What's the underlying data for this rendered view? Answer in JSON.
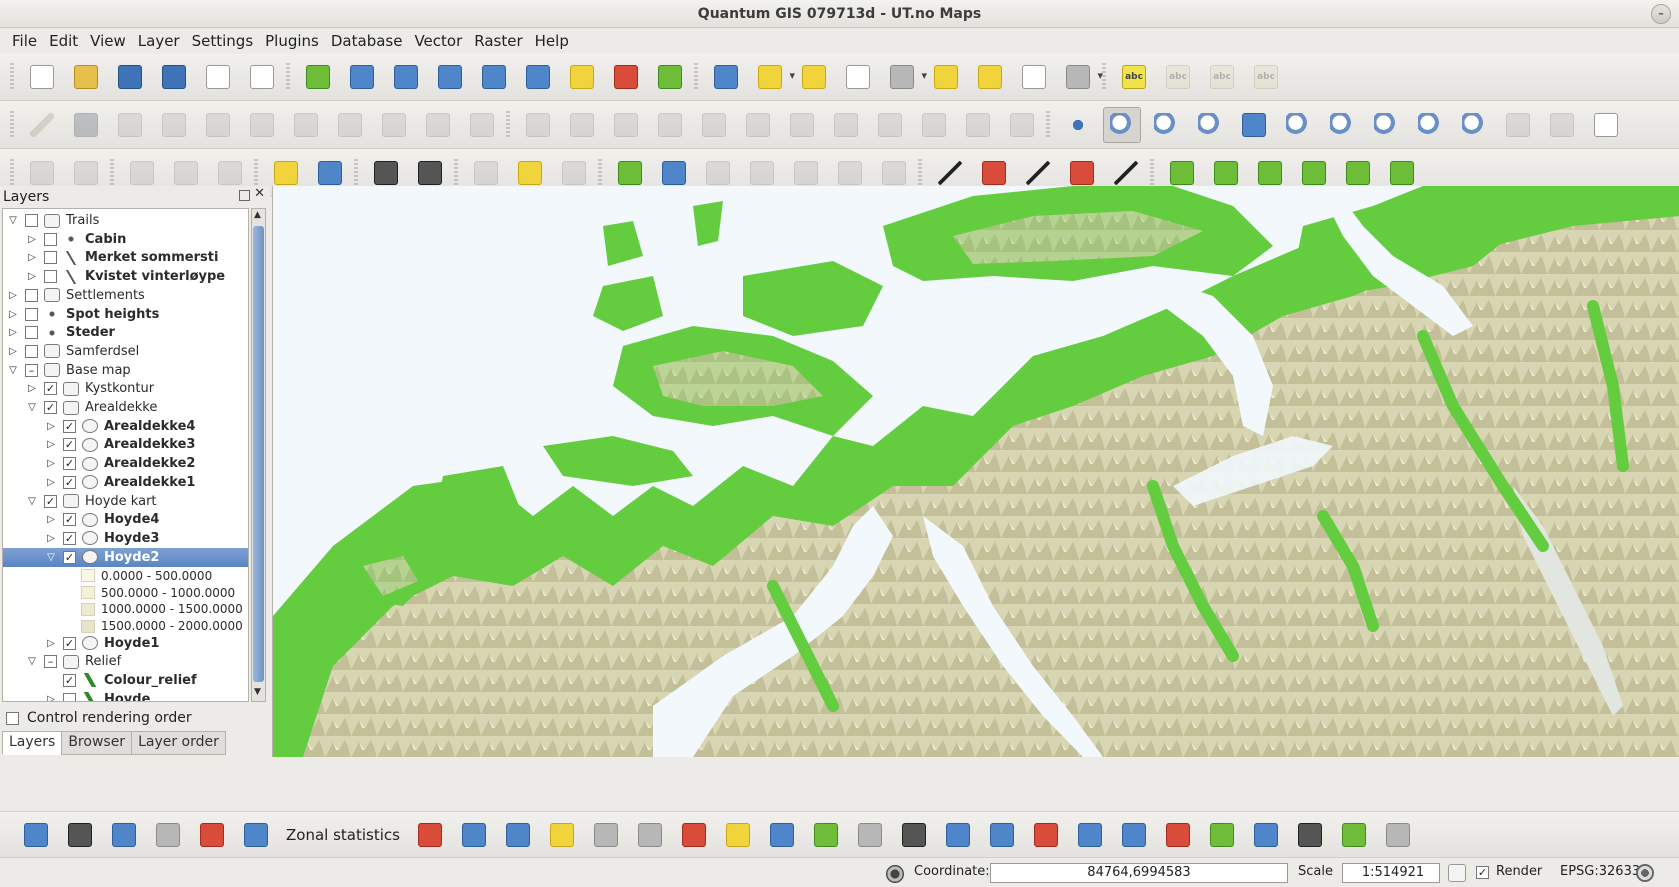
{
  "window": {
    "title": "Quantum GIS 079713d - UT.no Maps"
  },
  "menu": [
    "File",
    "Edit",
    "View",
    "Layer",
    "Settings",
    "Plugins",
    "Database",
    "Vector",
    "Raster",
    "Help"
  ],
  "layers_panel": {
    "title": "Layers",
    "control_rendering_order": "Control rendering order",
    "tabs": [
      "Layers",
      "Browser",
      "Layer order"
    ],
    "tree": [
      {
        "label": "Trails",
        "level": 0,
        "expanded": true,
        "checked": "none",
        "icon": "group",
        "bold": false
      },
      {
        "label": "Cabin",
        "level": 1,
        "expanded": false,
        "checked": "none",
        "icon": "point",
        "bold": true
      },
      {
        "label": "Merket sommersti",
        "level": 1,
        "expanded": false,
        "checked": "none",
        "icon": "line",
        "bold": true
      },
      {
        "label": "Kvistet vinterløype",
        "level": 1,
        "expanded": false,
        "checked": "none",
        "icon": "line",
        "bold": true
      },
      {
        "label": "Settlements",
        "level": 0,
        "expanded": false,
        "checked": "none",
        "icon": "group",
        "bold": false
      },
      {
        "label": "Spot heights",
        "level": 0,
        "expanded": false,
        "checked": "none",
        "icon": "point",
        "bold": true
      },
      {
        "label": "Steder",
        "level": 0,
        "expanded": false,
        "checked": "none",
        "icon": "point",
        "bold": true
      },
      {
        "label": "Samferdsel",
        "level": 0,
        "expanded": false,
        "checked": "none",
        "icon": "group",
        "bold": false
      },
      {
        "label": "Base map",
        "level": 0,
        "expanded": true,
        "checked": "partial",
        "icon": "group",
        "bold": false
      },
      {
        "label": "Kystkontur",
        "level": 1,
        "expanded": false,
        "checked": "checked",
        "icon": "group",
        "bold": false
      },
      {
        "label": "Arealdekke",
        "level": 1,
        "expanded": true,
        "checked": "checked",
        "icon": "group",
        "bold": false
      },
      {
        "label": "Arealdekke4",
        "level": 2,
        "expanded": false,
        "checked": "checked",
        "icon": "poly",
        "bold": true
      },
      {
        "label": "Arealdekke3",
        "level": 2,
        "expanded": false,
        "checked": "checked",
        "icon": "poly",
        "bold": true
      },
      {
        "label": "Arealdekke2",
        "level": 2,
        "expanded": false,
        "checked": "checked",
        "icon": "poly",
        "bold": true
      },
      {
        "label": "Arealdekke1",
        "level": 2,
        "expanded": false,
        "checked": "checked",
        "icon": "poly",
        "bold": true
      },
      {
        "label": "Hoyde kart",
        "level": 1,
        "expanded": true,
        "checked": "checked",
        "icon": "group",
        "bold": false
      },
      {
        "label": "Hoyde4",
        "level": 2,
        "expanded": false,
        "checked": "checked",
        "icon": "poly",
        "bold": true
      },
      {
        "label": "Hoyde3",
        "level": 2,
        "expanded": false,
        "checked": "checked",
        "icon": "poly",
        "bold": true
      },
      {
        "label": "Hoyde2",
        "level": 2,
        "expanded": true,
        "checked": "checked",
        "icon": "poly",
        "bold": true,
        "selected": true
      },
      {
        "label": "Hoyde1",
        "level": 2,
        "expanded": false,
        "checked": "checked",
        "icon": "poly",
        "bold": true
      },
      {
        "label": "Relief",
        "level": 1,
        "expanded": true,
        "checked": "partial",
        "icon": "group",
        "bold": false
      },
      {
        "label": "Colour_relief",
        "level": 2,
        "expanded": null,
        "checked": "checked",
        "icon": "relief",
        "bold": true
      },
      {
        "label": "Hoyde",
        "level": 2,
        "expanded": false,
        "checked": "none",
        "icon": "relief",
        "bold": true
      }
    ],
    "legend": [
      {
        "label": "0.0000 - 500.0000",
        "color": "#fbf8e6"
      },
      {
        "label": "500.0000 - 1000.0000",
        "color": "#f5f0d8"
      },
      {
        "label": "1000.0000 - 1500.0000",
        "color": "#efe9cd"
      },
      {
        "label": "1500.0000 - 2000.0000",
        "color": "#e8e4cc"
      }
    ]
  },
  "bottom_toolbar": {
    "zonal_label": "Zonal statistics"
  },
  "status": {
    "coordinate_label": "Coordinate:",
    "coordinate_value": "84764,6994583",
    "scale_label": "Scale",
    "scale_value": "1:514921",
    "render_label": "Render",
    "epsg": "EPSG:32633"
  },
  "map_colors": {
    "water": "#f2f8fc",
    "lowland": "#63cc3f",
    "terrain": "#d9d7b5"
  }
}
